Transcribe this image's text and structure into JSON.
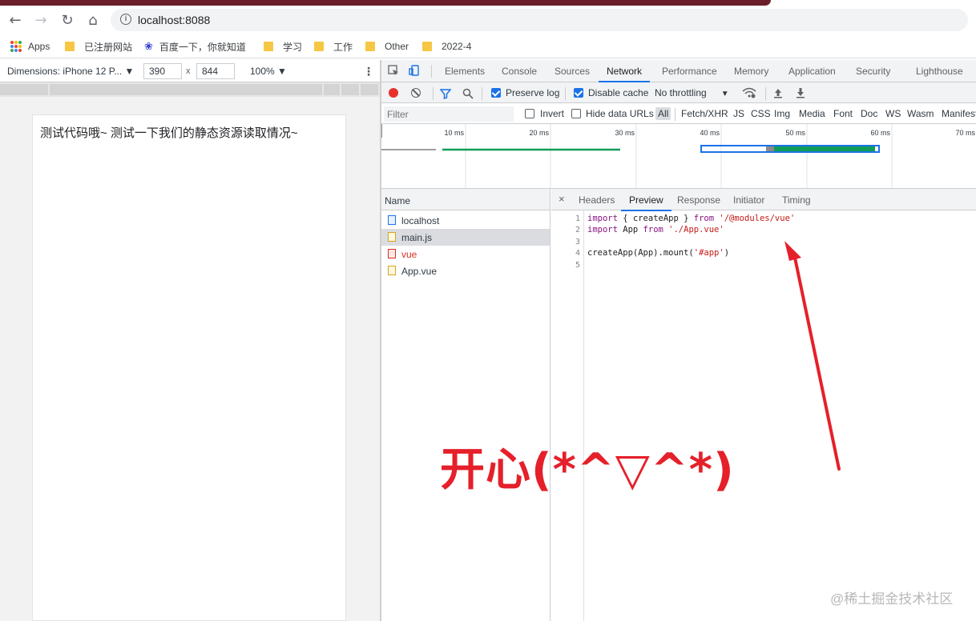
{
  "browser": {
    "url": "localhost:8088",
    "bookmarks": [
      "Apps",
      "已注册网站",
      "百度一下，你就知道",
      "学习",
      "工作",
      "Other",
      "2022-4"
    ]
  },
  "device_toolbar": {
    "dimensions_label": "Dimensions: iPhone 12 P...",
    "width": "390",
    "height": "844",
    "times": "x",
    "zoom": "100%",
    "caret": "▼"
  },
  "page": {
    "text": "测试代码哦~ 测试一下我们的静态资源读取情况~"
  },
  "devtools": {
    "tabs": [
      "Elements",
      "Console",
      "Sources",
      "Network",
      "Performance",
      "Memory",
      "Application",
      "Security",
      "Lighthouse"
    ],
    "active_tab": "Network",
    "network_toolbar": {
      "preserve_log": "Preserve log",
      "disable_cache": "Disable cache",
      "throttling": "No throttling"
    },
    "filter": {
      "placeholder": "Filter",
      "invert": "Invert",
      "hide_data_urls": "Hide data URLs",
      "types": [
        "All",
        "Fetch/XHR",
        "JS",
        "CSS",
        "Img",
        "Media",
        "Font",
        "Doc",
        "WS",
        "Wasm",
        "Manifest"
      ]
    },
    "timeline_ticks": [
      "10 ms",
      "20 ms",
      "30 ms",
      "40 ms",
      "50 ms",
      "60 ms",
      "70 ms"
    ],
    "requests": {
      "header": "Name",
      "items": [
        {
          "name": "localhost",
          "type": "doc"
        },
        {
          "name": "main.js",
          "type": "js",
          "selected": true
        },
        {
          "name": "vue",
          "type": "err"
        },
        {
          "name": "App.vue",
          "type": "js"
        }
      ]
    },
    "detail_tabs": [
      "Headers",
      "Preview",
      "Response",
      "Initiator",
      "Timing"
    ],
    "detail_close": "×",
    "code": {
      "line_numbers": [
        "1",
        "2",
        "3",
        "4",
        "5"
      ],
      "l1_kw": "import",
      "l1_mid": " { createApp } ",
      "l1_from": "from",
      "l1_str": " '/@modules/vue'",
      "l2_kw": "import",
      "l2_mid": " App ",
      "l2_from": "from",
      "l2_str": " './App.vue'",
      "l4_code": "createApp(App).mount(",
      "l4_str": "'#app'",
      "l4_end": ")"
    }
  },
  "annotation": {
    "text": "开心(*^▽^*)",
    "color": "#e5202a"
  },
  "watermark": "@稀土掘金技术社区"
}
